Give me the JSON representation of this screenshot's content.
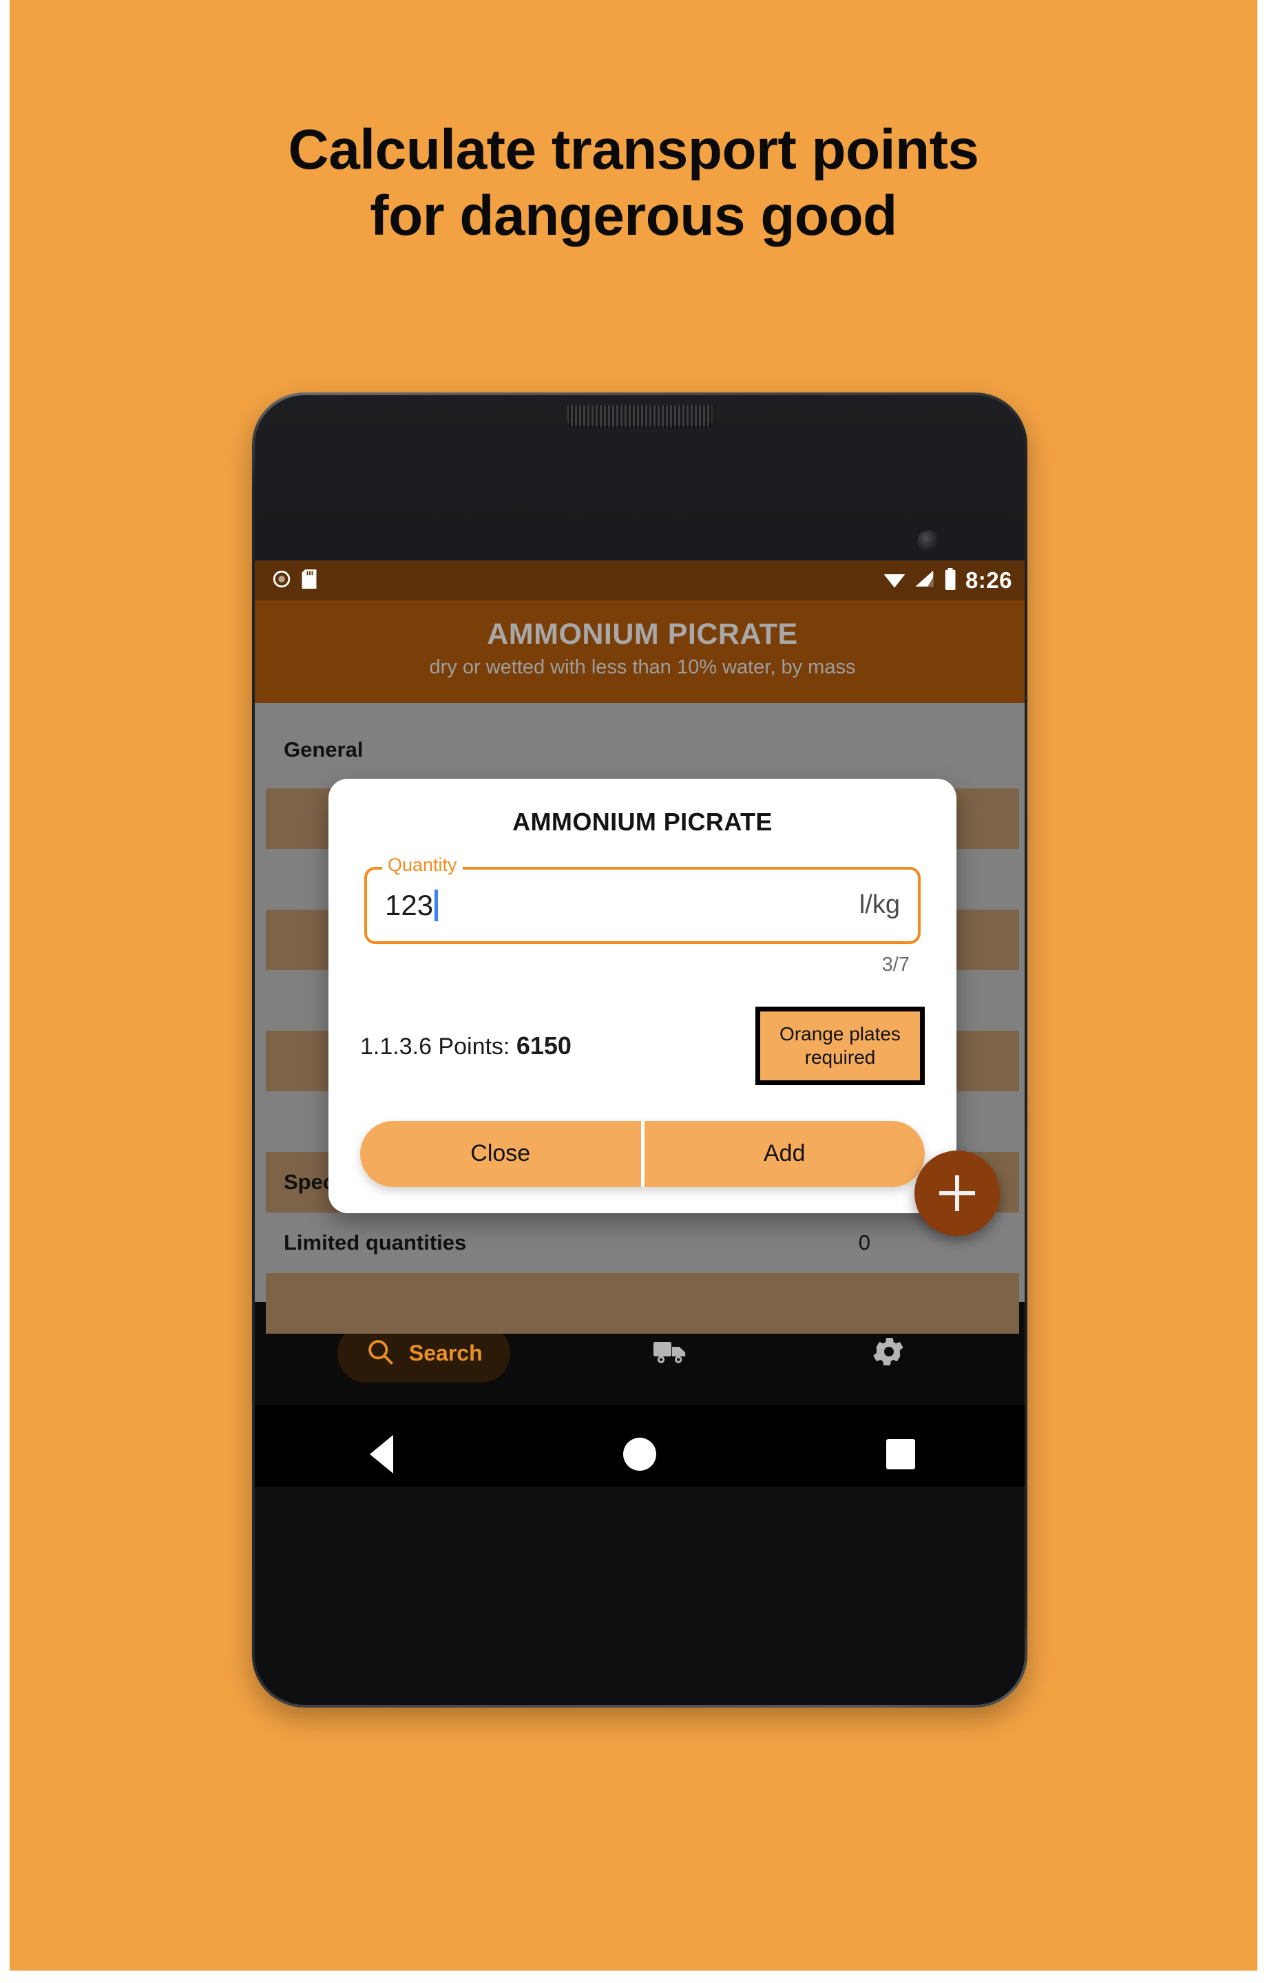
{
  "poster": {
    "background_color": "#F3A243",
    "headline_line1": "Calculate transport points",
    "headline_line2": "for dangerous good"
  },
  "statusbar": {
    "time": "8:26",
    "icons": [
      "record-icon",
      "sd-card-icon",
      "wifi-icon",
      "cell-signal-icon",
      "battery-icon"
    ]
  },
  "appbar": {
    "background_color": "#7A3F09",
    "title": "AMMONIUM PICRATE",
    "subtitle": "dry or wetted with less than 10% water, by mass"
  },
  "list": {
    "rows": [
      {
        "label": "General",
        "value": ""
      },
      {
        "label": "Special Provisions",
        "value": ""
      },
      {
        "label": "Limited quantities",
        "value": "0"
      }
    ]
  },
  "fab": {
    "icon": "plus-icon",
    "color": "#8A3D0C"
  },
  "dialog": {
    "title": "AMMONIUM PICRATE",
    "field": {
      "label": "Quantity",
      "value": "123",
      "suffix": "l/kg",
      "counter": "3/7",
      "accent_color": "#F28C1E"
    },
    "points_label": "1.1.3.6 Points:",
    "points_value": "6150",
    "badge_line1": "Orange plates",
    "badge_line2": "required",
    "badge_color": "#F5AB5C",
    "close_label": "Close",
    "add_label": "Add",
    "button_color": "#F5AB5C"
  },
  "bottomnav": {
    "items": [
      {
        "label": "Search",
        "icon": "search-icon",
        "active": true
      },
      {
        "label": "",
        "icon": "truck-icon",
        "active": false
      },
      {
        "label": "",
        "icon": "gear-icon",
        "active": false
      }
    ],
    "active_color": "#E8912A"
  },
  "androidnav": {
    "buttons": [
      "back-button",
      "home-button",
      "recents-button"
    ]
  }
}
